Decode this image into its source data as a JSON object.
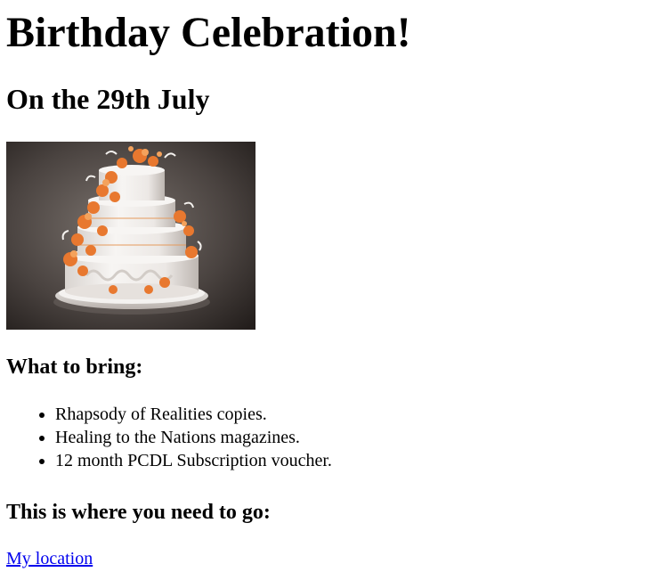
{
  "heading": "Birthday Celebration!",
  "date": "On the 29th July",
  "image": {
    "subject": "tiered birthday cake with orange flowers",
    "colors": {
      "background_dark": "#2a2523",
      "background_light": "#6b6460",
      "cake_white": "#f2f0ee",
      "cake_shadow": "#cfc9c5",
      "flower": "#e8782f",
      "flower_light": "#f4a25c"
    }
  },
  "bring": {
    "heading": "What to bring:",
    "items": [
      "Rhapsody of Realities copies.",
      "Healing to the Nations magazines.",
      "12 month PCDL Subscription voucher."
    ]
  },
  "where": {
    "heading": "This is where you need to go:",
    "link_text": "My location"
  },
  "colors": {
    "link": "#0000ee",
    "text": "#000000",
    "background": "#ffffff"
  }
}
